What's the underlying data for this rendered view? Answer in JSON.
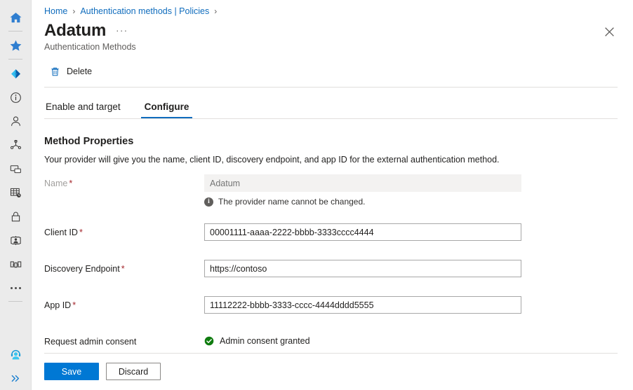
{
  "rail": {
    "items": [
      {
        "name": "home-icon",
        "label": "Home"
      },
      {
        "name": "favorites-star-icon",
        "label": "Favorites"
      },
      {
        "name": "azure-entra-diamond-icon",
        "label": "Microsoft Entra ID"
      },
      {
        "name": "info-icon",
        "label": "Information"
      },
      {
        "name": "user-icon",
        "label": "Users"
      },
      {
        "name": "groups-icon",
        "label": "Groups"
      },
      {
        "name": "devices-icon",
        "label": "Devices"
      },
      {
        "name": "applications-grid-icon",
        "label": "Applications"
      },
      {
        "name": "lock-icon",
        "label": "Protection"
      },
      {
        "name": "identity-governance-icon",
        "label": "Identity governance"
      },
      {
        "name": "hybrid-connect-icon",
        "label": "Hybrid management"
      },
      {
        "name": "more-ellipsis-icon",
        "label": "Show more"
      },
      {
        "name": "support-agent-icon",
        "label": "Support"
      },
      {
        "name": "expand-chevrons-icon",
        "label": "Expand"
      }
    ]
  },
  "breadcrumb": {
    "items": [
      "Home",
      "Authentication methods | Policies"
    ],
    "separator": "›"
  },
  "header": {
    "title": "Adatum",
    "ellipsis": "···",
    "subtitle": "Authentication Methods",
    "close_icon": "close-icon"
  },
  "commandbar": {
    "delete_label": "Delete",
    "delete_icon": "trash-icon"
  },
  "tabs": [
    {
      "label": "Enable and target",
      "active": false
    },
    {
      "label": "Configure",
      "active": true
    }
  ],
  "section": {
    "title": "Method Properties",
    "description": "Your provider will give you the name, client ID, discovery endpoint, and app ID for the external authentication method."
  },
  "form": {
    "name": {
      "label": "Name",
      "required": "*",
      "value": "",
      "placeholder": "Adatum",
      "disabled": true,
      "hint": "The provider name cannot be changed.",
      "hint_icon": "info-icon"
    },
    "client_id": {
      "label": "Client ID",
      "required": "*",
      "value": "00001111-aaaa-2222-bbbb-3333cccc4444",
      "placeholder": ""
    },
    "discovery_endpoint": {
      "label": "Discovery Endpoint",
      "required": "*",
      "value": "https://contoso",
      "placeholder": ""
    },
    "app_id": {
      "label": "App ID",
      "required": "*",
      "value": "11112222-bbbb-3333-cccc-4444dddd5555",
      "placeholder": ""
    },
    "admin_consent": {
      "label": "Request admin consent",
      "status_text": "Admin consent granted",
      "status_icon": "check-circle-icon"
    }
  },
  "footer": {
    "save_label": "Save",
    "discard_label": "Discard"
  },
  "colors": {
    "accent": "#0078d4",
    "link": "#0f6cbd",
    "success": "#107c10",
    "required": "#a4262c",
    "rail_bg": "#ebebeb"
  }
}
